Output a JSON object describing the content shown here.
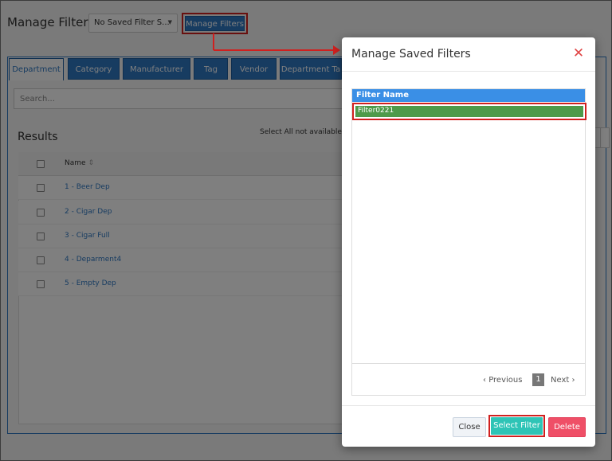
{
  "header": {
    "title": "Manage Filters",
    "saved_filter_select": "No Saved Filter S...",
    "manage_filters_button": "Manage Filters"
  },
  "tabs": [
    "Department",
    "Category",
    "Manufacturer",
    "Tag",
    "Vendor",
    "Department Ta"
  ],
  "search": {
    "placeholder": "Search..."
  },
  "results": {
    "title": "Results",
    "select_all_note": "Select All not available fo",
    "name_column": "Name",
    "sort_icon": "sort-icon",
    "rows": [
      "1 - Beer Dep",
      "2 - Cigar Dep",
      "3 - Cigar Full",
      "4 - Deparment4",
      "5 - Empty Dep"
    ]
  },
  "modal": {
    "title": "Manage Saved Filters",
    "close_symbol": "✕",
    "list_header": "Filter Name",
    "filters": [
      "Filter0221"
    ],
    "pagination": {
      "previous": "Previous",
      "page": "1",
      "next": "Next"
    },
    "buttons": {
      "close": "Close",
      "select": "Select Filter",
      "delete": "Delete"
    }
  },
  "colors": {
    "primary": "#2e78c3",
    "highlight": "#d0201f",
    "selected_row": "#4e9a4a",
    "select_button": "#2ec4b6",
    "delete_button": "#ef4f67"
  }
}
